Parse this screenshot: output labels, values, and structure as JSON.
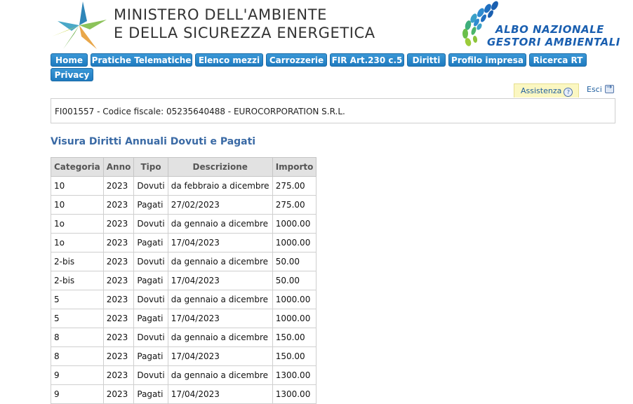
{
  "header": {
    "ministry_line1": "MINISTERO DELL'AMBIENTE",
    "ministry_line2": "E DELLA SICUREZZA ENERGETICA",
    "albo_line1": "ALBO NAZIONALE",
    "albo_line2": "GESTORI AMBIENTALI"
  },
  "nav": [
    {
      "label": "Home"
    },
    {
      "label": "Pratiche Telematiche"
    },
    {
      "label": "Elenco mezzi"
    },
    {
      "label": "Carrozzerie"
    },
    {
      "label": "FIR Art.230 c.5"
    },
    {
      "label": "Diritti"
    },
    {
      "label": "Profilo impresa"
    },
    {
      "label": "Ricerca RT"
    },
    {
      "label": "Privacy"
    }
  ],
  "utility": {
    "assistenza": "Assistenza",
    "assistenza_icon": "help-icon",
    "esci": "Esci",
    "esci_icon": "exit-icon"
  },
  "company_info": "FI001557 - Codice fiscale: 05235640488 - EUROCORPORATION S.R.L.",
  "section_title": "Visura Diritti Annuali Dovuti e Pagati",
  "table": {
    "headers": [
      "Categoria",
      "Anno",
      "Tipo",
      "Descrizione",
      "Importo"
    ],
    "rows": [
      [
        "10",
        "2023",
        "Dovuti",
        "da febbraio a dicembre",
        "275.00"
      ],
      [
        "10",
        "2023",
        "Pagati",
        "27/02/2023",
        "275.00"
      ],
      [
        "1o",
        "2023",
        "Dovuti",
        "da gennaio a dicembre",
        "1000.00"
      ],
      [
        "1o",
        "2023",
        "Pagati",
        "17/04/2023",
        "1000.00"
      ],
      [
        "2-bis",
        "2023",
        "Dovuti",
        "da gennaio a dicembre",
        "50.00"
      ],
      [
        "2-bis",
        "2023",
        "Pagati",
        "17/04/2023",
        "50.00"
      ],
      [
        "5",
        "2023",
        "Dovuti",
        "da gennaio a dicembre",
        "1000.00"
      ],
      [
        "5",
        "2023",
        "Pagati",
        "17/04/2023",
        "1000.00"
      ],
      [
        "8",
        "2023",
        "Dovuti",
        "da gennaio a dicembre",
        "150.00"
      ],
      [
        "8",
        "2023",
        "Pagati",
        "17/04/2023",
        "150.00"
      ],
      [
        "9",
        "2023",
        "Dovuti",
        "da gennaio a dicembre",
        "1300.00"
      ],
      [
        "9",
        "2023",
        "Pagati",
        "17/04/2023",
        "1300.00"
      ]
    ]
  },
  "colors": {
    "nav_button": "#2a88cb",
    "section_title": "#3a6aa5",
    "header_text": "#333333",
    "albo_text": "#1a5fb0"
  }
}
